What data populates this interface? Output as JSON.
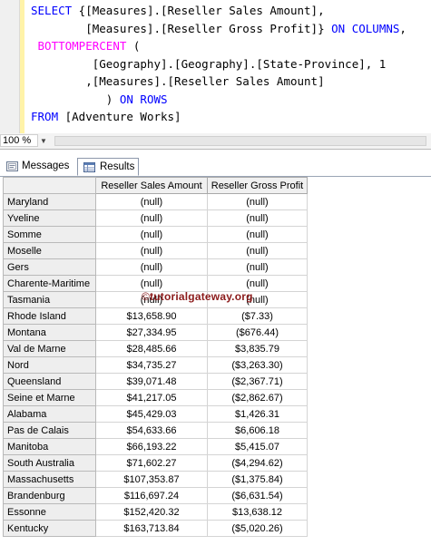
{
  "editor": {
    "lines": [
      [
        {
          "t": "SELECT",
          "c": "kw"
        },
        {
          "t": " {[Measures].[Reseller Sales Amount],"
        }
      ],
      [
        {
          "t": "        [Measures].[Reseller Gross Profit]} "
        },
        {
          "t": "ON COLUMNS",
          "c": "kw"
        },
        {
          "t": ","
        }
      ],
      [
        {
          "t": " "
        },
        {
          "t": "BOTTOMPERCENT",
          "c": "fn"
        },
        {
          "t": " ("
        }
      ],
      [
        {
          "t": "         [Geography].[Geography].[State-Province], 1"
        }
      ],
      [
        {
          "t": "        ,[Measures].[Reseller Sales Amount]"
        }
      ],
      [
        {
          "t": "           ) "
        },
        {
          "t": "ON ROWS",
          "c": "kw"
        }
      ],
      [
        {
          "t": "FROM",
          "c": "kw"
        },
        {
          "t": " [Adventure Works]"
        }
      ]
    ]
  },
  "zoom": {
    "value": "100 %"
  },
  "tabs": {
    "messages": "Messages",
    "results": "Results"
  },
  "grid": {
    "columns": [
      "Reseller Sales Amount",
      "Reseller Gross Profit"
    ],
    "rows": [
      {
        "name": "Maryland",
        "sales": "(null)",
        "profit": "(null)"
      },
      {
        "name": "Yveline",
        "sales": "(null)",
        "profit": "(null)"
      },
      {
        "name": "Somme",
        "sales": "(null)",
        "profit": "(null)"
      },
      {
        "name": "Moselle",
        "sales": "(null)",
        "profit": "(null)"
      },
      {
        "name": "Gers",
        "sales": "(null)",
        "profit": "(null)"
      },
      {
        "name": "Charente-Maritime",
        "sales": "(null)",
        "profit": "(null)"
      },
      {
        "name": "Tasmania",
        "sales": "(null)",
        "profit": "(null)"
      },
      {
        "name": "Rhode Island",
        "sales": "$13,658.90",
        "profit": "($7.33)"
      },
      {
        "name": "Montana",
        "sales": "$27,334.95",
        "profit": "($676.44)"
      },
      {
        "name": "Val de Marne",
        "sales": "$28,485.66",
        "profit": "$3,835.79"
      },
      {
        "name": "Nord",
        "sales": "$34,735.27",
        "profit": "($3,263.30)"
      },
      {
        "name": "Queensland",
        "sales": "$39,071.48",
        "profit": "($2,367.71)"
      },
      {
        "name": "Seine et Marne",
        "sales": "$41,217.05",
        "profit": "($2,862.67)"
      },
      {
        "name": "Alabama",
        "sales": "$45,429.03",
        "profit": "$1,426.31"
      },
      {
        "name": "Pas de Calais",
        "sales": "$54,633.66",
        "profit": "$6,606.18"
      },
      {
        "name": "Manitoba",
        "sales": "$66,193.22",
        "profit": "$5,415.07"
      },
      {
        "name": "South Australia",
        "sales": "$71,602.27",
        "profit": "($4,294.62)"
      },
      {
        "name": "Massachusetts",
        "sales": "$107,353.87",
        "profit": "($1,375.84)"
      },
      {
        "name": "Brandenburg",
        "sales": "$116,697.24",
        "profit": "($6,631.54)"
      },
      {
        "name": "Essonne",
        "sales": "$152,420.32",
        "profit": "$13,638.12"
      },
      {
        "name": "Kentucky",
        "sales": "$163,713.84",
        "profit": "($5,020.26)"
      }
    ]
  },
  "watermark": {
    "symbol": "©",
    "text": "tutorialgateway.org"
  },
  "icons": {
    "messages": "messages-icon",
    "results": "grid-icon"
  }
}
